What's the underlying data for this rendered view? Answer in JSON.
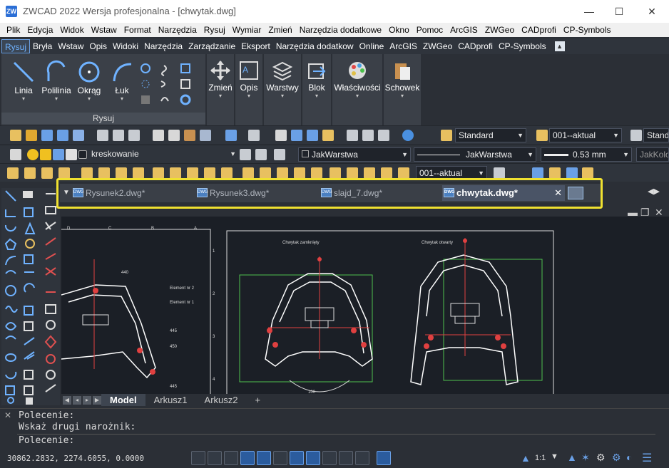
{
  "app": {
    "title": "ZWCAD 2022 Wersja profesjonalna - [chwytak.dwg]",
    "logo": "ZW"
  },
  "window_buttons": [
    "—",
    "☐",
    "✕"
  ],
  "menu": [
    "Plik",
    "Edycja",
    "Widok",
    "Wstaw",
    "Format",
    "Narzędzia",
    "Rysuj",
    "Wymiar",
    "Zmień",
    "Narzędzia dodatkowe",
    "Okno",
    "Pomoc",
    "ArcGIS",
    "ZWGeo",
    "CADprofi",
    "CP-Symbols"
  ],
  "ribbon_tabs": [
    "Rysuj",
    "Bryła",
    "Wstaw",
    "Opis",
    "Widoki",
    "Narzędzia",
    "Zarządzanie",
    "Eksport",
    "Narzędzia dodatkow",
    "Online",
    "ArcGIS",
    "ZWGeo",
    "CADprofi",
    "CP-Symbols"
  ],
  "ribbon_tab_active": "Rysuj",
  "ribbon": {
    "draw_panel_title": "Rysuj",
    "draw_tools": [
      "Linia",
      "Polilinia",
      "Okrąg",
      "Łuk"
    ],
    "big_tools": [
      "Zmień",
      "Opis",
      "Warstwy",
      "Blok",
      "Właściwości",
      "Schowek"
    ]
  },
  "toolbar": {
    "text_style": "Standard",
    "dim_style": "001--aktual",
    "table_style": "Standa",
    "layer": "kreskowanie",
    "color": "JakWarstwa",
    "linetype": "JakWarstwa",
    "lineweight": "0.53 mm",
    "plotstyle": "JakKolo",
    "dim_layer": "001--aktual"
  },
  "doc_tabs": [
    "Rysunek2.dwg*",
    "Rysunek3.dwg*",
    "slajd_7.dwg*",
    "chwytak.dwg*"
  ],
  "doc_tab_active": "chwytak.dwg*",
  "drawing": {
    "labels": [
      "Chwytak zamknięty",
      "Chwytak otwarty",
      "Element nr 2",
      "Element nr 1"
    ],
    "dims": [
      "440",
      "445",
      "450",
      "445",
      "100"
    ],
    "columns": [
      "D",
      "C",
      "B",
      "A"
    ],
    "rows": [
      "1",
      "2",
      "3",
      "4"
    ]
  },
  "sheet_tabs": [
    "Model",
    "Arkusz1",
    "Arkusz2",
    "+"
  ],
  "sheet_tab_active": "Model",
  "command": {
    "line1": "Polecenie:",
    "line2": "Wskaż drugi narożnik:",
    "prompt": "Polecenie:"
  },
  "status": {
    "coords": "30862.2832, 2274.6055, 0.0000",
    "scale": "1:1"
  },
  "colors": {
    "accent": "#2b5c9e",
    "highlight": "#f0e130",
    "drawing_bg": "#1b1f26"
  }
}
